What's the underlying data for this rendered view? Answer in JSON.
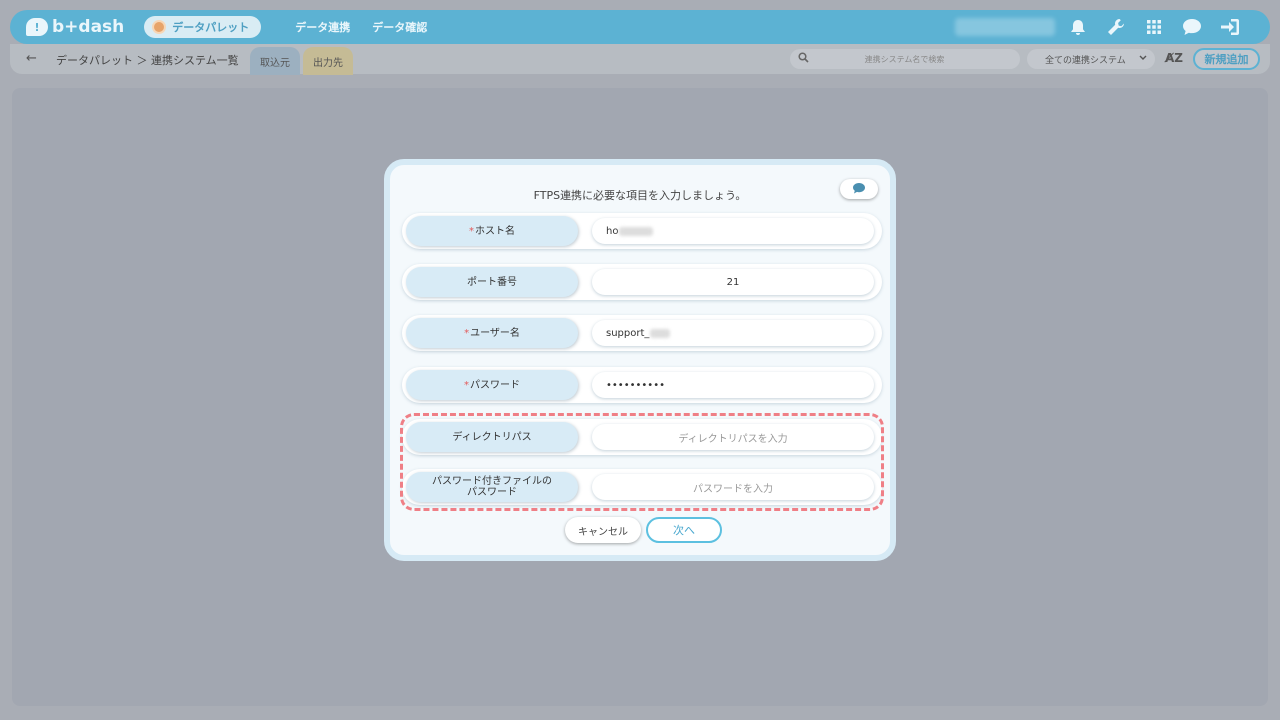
{
  "app": {
    "logo_text": "b+dash",
    "logo_mark": "!",
    "palette_label": "データパレット",
    "nav": [
      "データ連携",
      "データ確認"
    ]
  },
  "top_icons": [
    "bell-icon",
    "wrench-icon",
    "grid-icon",
    "chat-icon",
    "logout-icon"
  ],
  "subbar": {
    "breadcrumb": "データパレット ＞ 連携システム一覧",
    "tab_in": "取込元",
    "tab_out": "出力先",
    "search_placeholder": "連携システム名で検索",
    "filter_value": "全ての連携システム",
    "sort_label": "A͏Z",
    "new_button": "新規追加"
  },
  "modal": {
    "title": "FTPS連携に必要な項目を入力しましょう。",
    "fields": [
      {
        "label": "ホスト名",
        "required": true,
        "value": "ho",
        "placeholder": ""
      },
      {
        "label": "ポート番号",
        "required": false,
        "value": "21",
        "placeholder": ""
      },
      {
        "label": "ユーザー名",
        "required": true,
        "value": "support_",
        "placeholder": ""
      },
      {
        "label": "パスワード",
        "required": true,
        "value": "••••••••••",
        "placeholder": ""
      },
      {
        "label": "ディレクトリパス",
        "required": false,
        "value": "",
        "placeholder": "ディレクトリパスを入力"
      },
      {
        "label": "パスワード付きファイルの\nパスワード",
        "required": false,
        "value": "",
        "placeholder": "パスワードを入力"
      }
    ],
    "required_mark": "*",
    "cancel_label": "キャンセル",
    "next_label": "次へ"
  },
  "colors": {
    "accent": "#5cb2d3",
    "highlight": "#ef7f86",
    "required": "#e35a5a"
  }
}
